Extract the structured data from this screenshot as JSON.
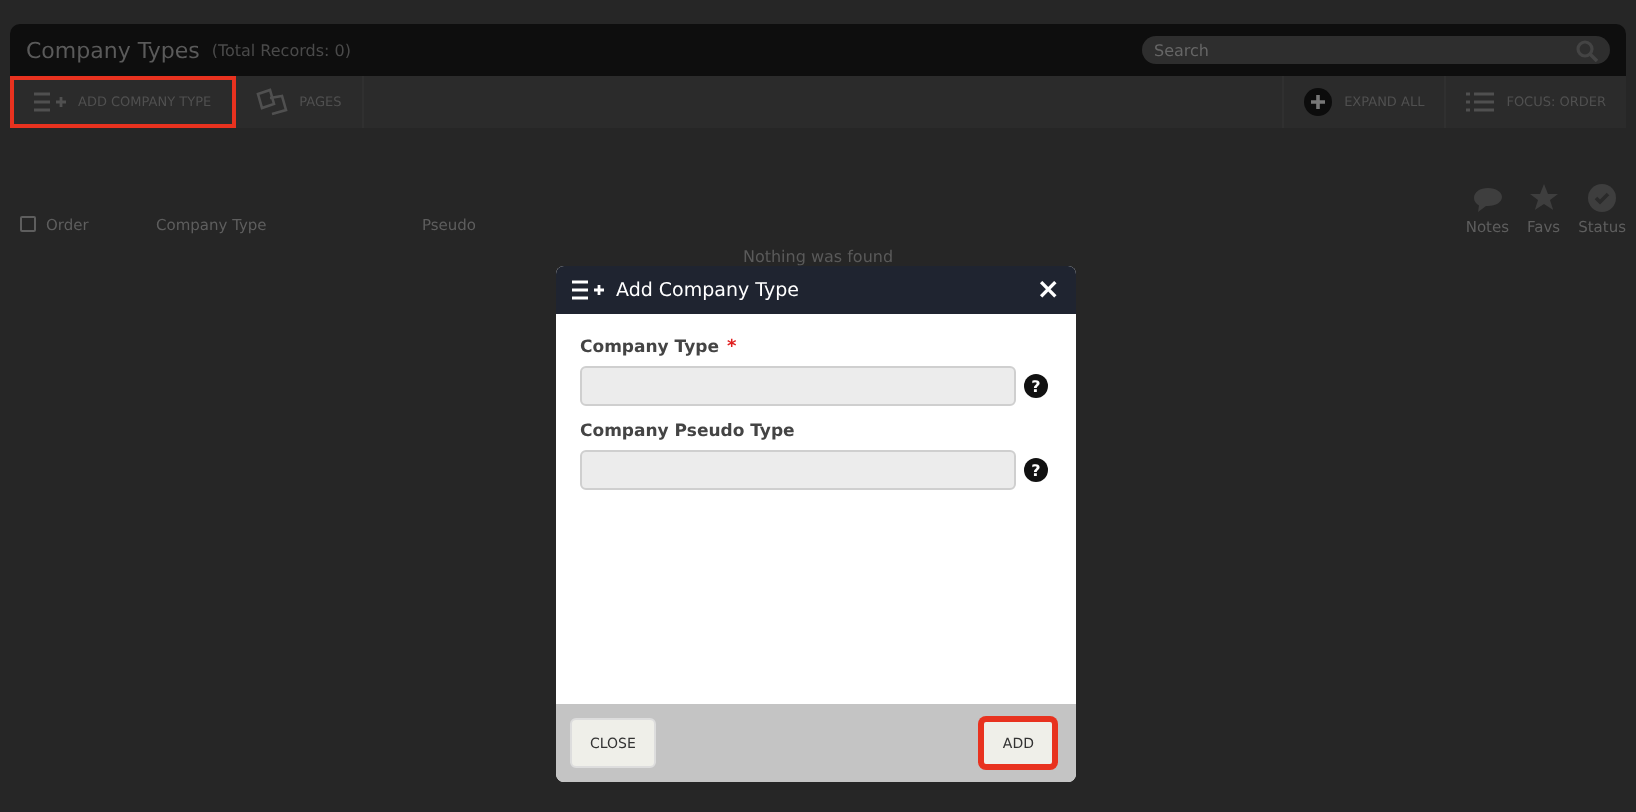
{
  "header": {
    "title": "Company Types",
    "subtitle": "(Total Records: 0)",
    "search": {
      "placeholder": "Search"
    }
  },
  "toolbar": {
    "left": [
      {
        "label": "ADD COMPANY TYPE",
        "highlighted": true
      },
      {
        "label": "PAGES",
        "highlighted": false
      }
    ],
    "right": [
      {
        "label": "EXPAND ALL"
      },
      {
        "label": "FOCUS: ORDER"
      }
    ]
  },
  "table": {
    "select_all": {
      "checked": false
    },
    "columns": [
      {
        "label": "Order"
      },
      {
        "label": "Company Type"
      },
      {
        "label": "Pseudo"
      }
    ],
    "icon_columns": [
      {
        "label": "Notes"
      },
      {
        "label": "Favs"
      },
      {
        "label": "Status"
      }
    ],
    "empty_message": "Nothing was found"
  },
  "dialog": {
    "title": "Add Company Type",
    "close_icon": "×",
    "fields": [
      {
        "label": "Company Type",
        "required_marker": "*",
        "help": "?"
      },
      {
        "label": "Company Pseudo Type",
        "help": "?"
      }
    ],
    "buttons": [
      {
        "label": "CLOSE",
        "highlighted": false
      },
      {
        "label": "ADD",
        "highlighted": true
      }
    ]
  }
}
